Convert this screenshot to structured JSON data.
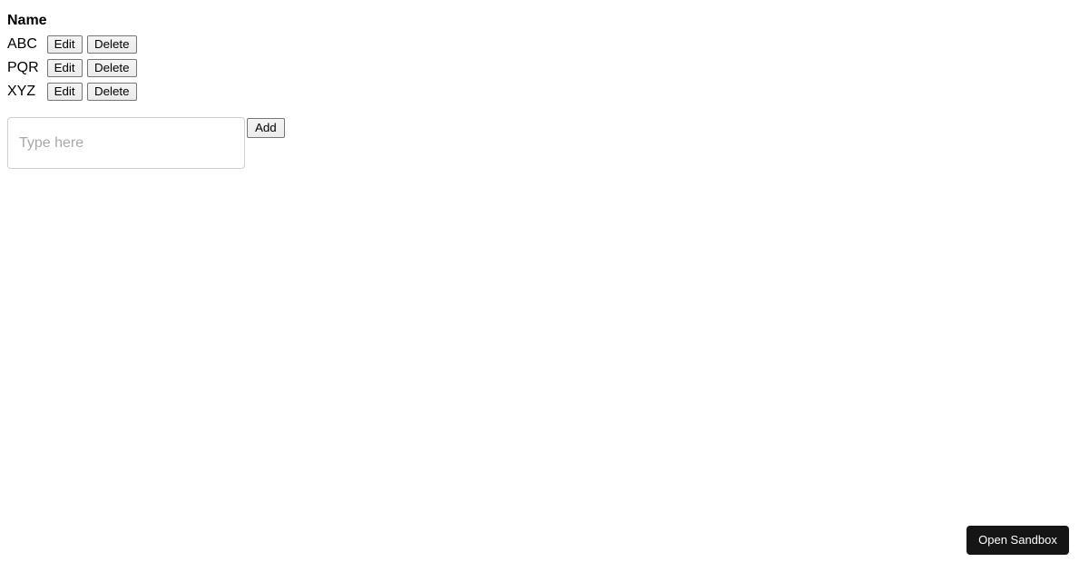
{
  "table": {
    "columns": [
      "Name",
      ""
    ],
    "header_name": "Name",
    "rows": [
      {
        "name": "ABC",
        "edit_label": "Edit",
        "delete_label": "Delete"
      },
      {
        "name": "PQR",
        "edit_label": "Edit",
        "delete_label": "Delete"
      },
      {
        "name": "XYZ",
        "edit_label": "Edit",
        "delete_label": "Delete"
      }
    ]
  },
  "add_form": {
    "input_value": "",
    "input_placeholder": "Type here",
    "add_label": "Add"
  },
  "overlay": {
    "sandbox_label": "Open Sandbox",
    "sandbox_bg": "#151515",
    "sandbox_text_color": "#ffffff"
  },
  "theme": {
    "page_bg": "#ffffff",
    "text_color": "#000000",
    "button_bg": "#efefef",
    "button_border": "#767676",
    "input_border": "#cfcfcf",
    "placeholder_color": "#a9a9a9"
  }
}
